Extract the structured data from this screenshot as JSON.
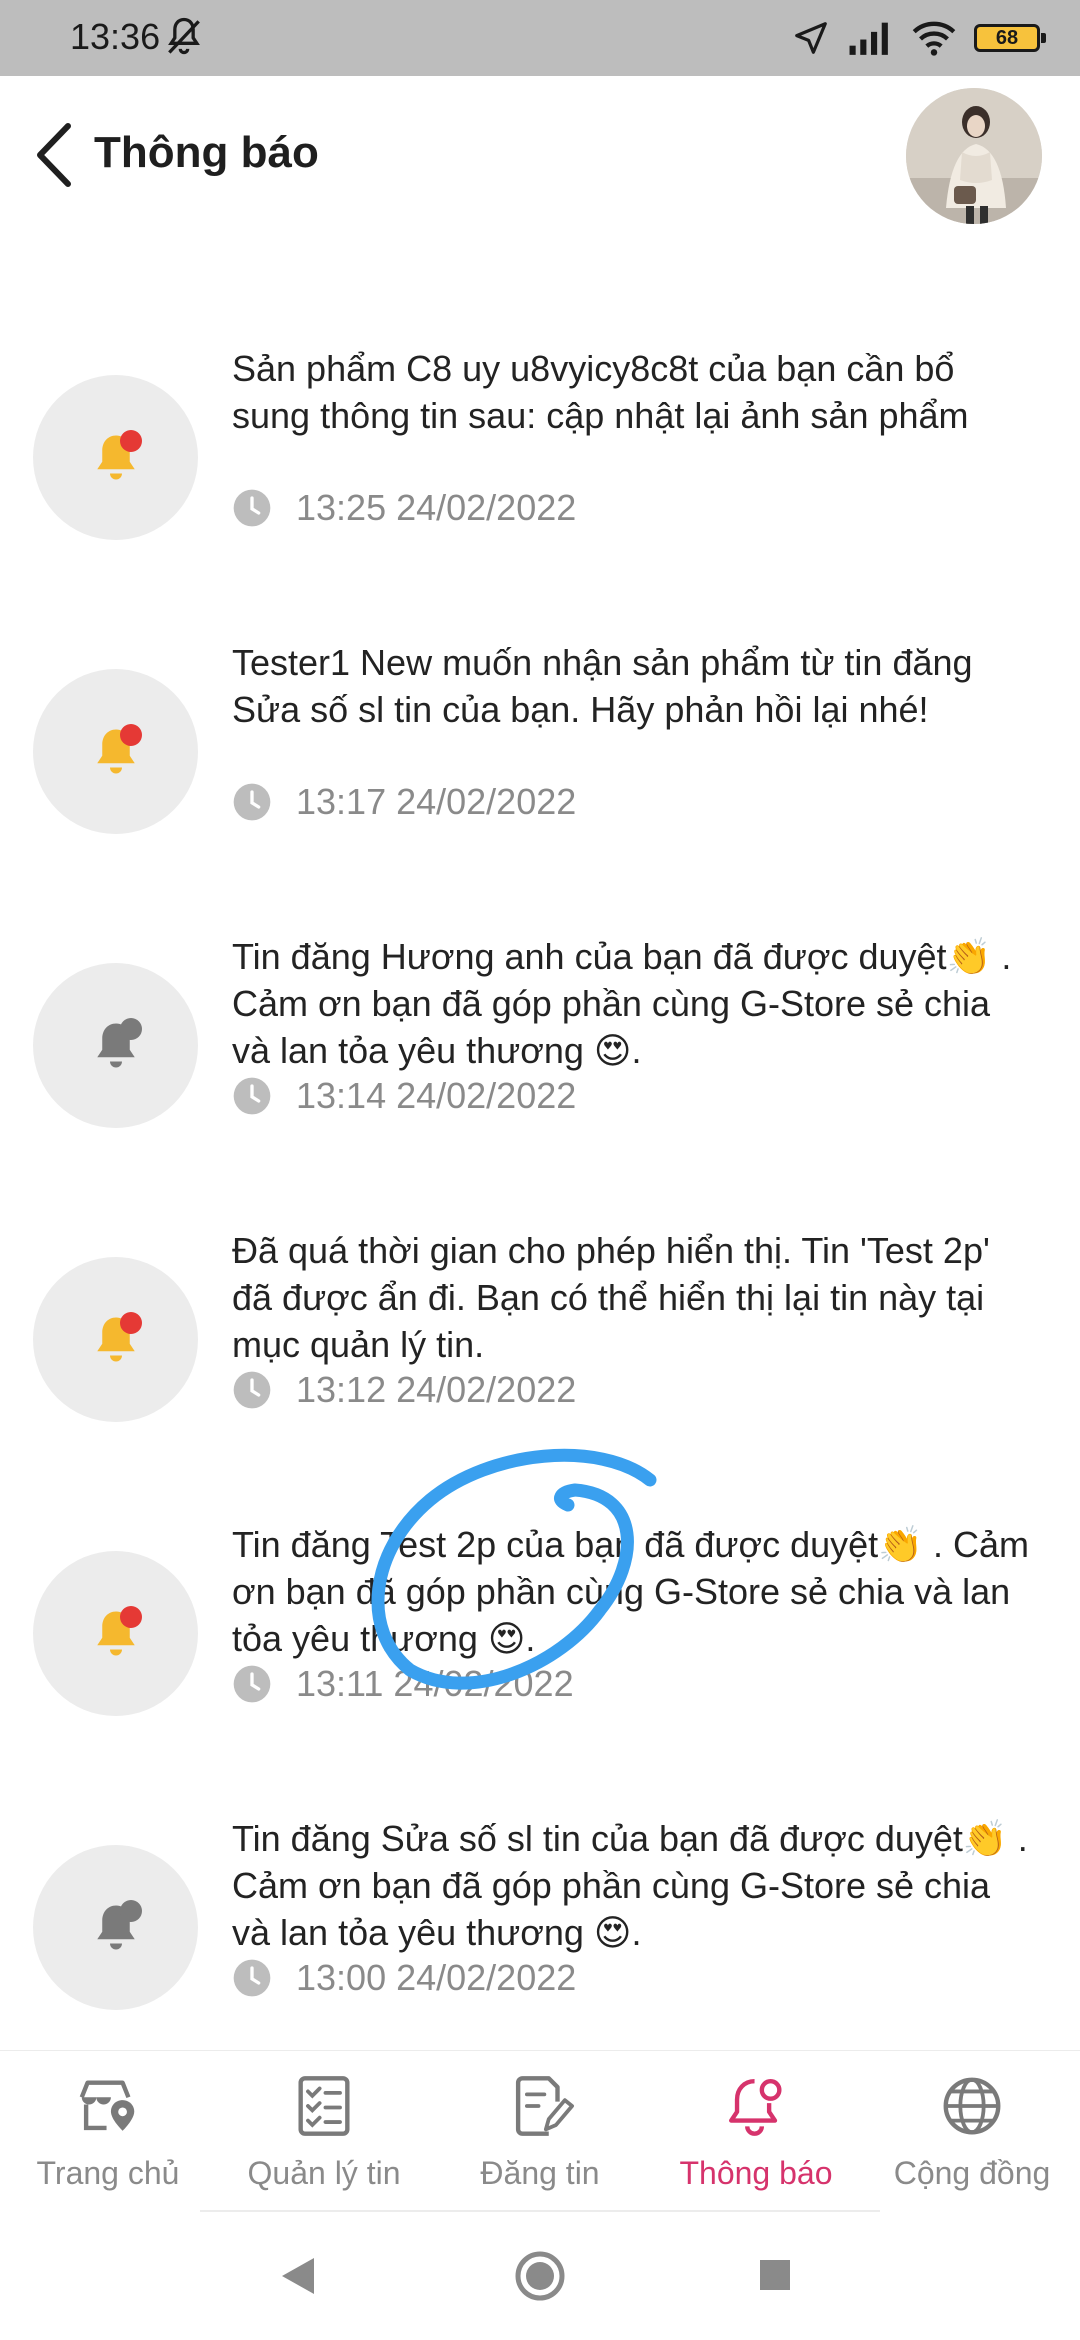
{
  "status_bar": {
    "time": "13:36",
    "battery": "68",
    "icons": [
      "bell-off-icon",
      "location-arrow-icon",
      "signal-icon",
      "wifi-icon",
      "battery-icon"
    ]
  },
  "header": {
    "title": "Thông báo",
    "back_icon": "chevron-left-icon"
  },
  "notifications": [
    {
      "text": "Sản phẩm C8 uy u8vyicy8c8t của bạn cần bổ sung thông tin sau: cập nhật lại ảnh sản phẩm",
      "time": "13:25 24/02/2022",
      "unread": true
    },
    {
      "text": "Tester1 New muốn nhận sản phẩm từ tin đăng Sửa số sl tin của bạn. Hãy phản hồi lại nhé!",
      "time": "13:17 24/02/2022",
      "unread": true
    },
    {
      "text": "Tin đăng Hương anh của bạn đã được duyệt👏 . Cảm ơn bạn đã góp phần cùng G-Store sẻ chia và lan tỏa yêu thương 😍.",
      "time": "13:14 24/02/2022",
      "unread": false
    },
    {
      "text": "Đã quá thời gian cho phép hiển thị. Tin 'Test 2p' đã được ẩn đi. Bạn có thể hiển thị lại tin này tại mục quản lý tin.",
      "time": "13:12 24/02/2022",
      "unread": true
    },
    {
      "text": "Tin đăng Test 2p của bạn đã được duyệt👏 . Cảm ơn bạn đã góp phần cùng G-Store sẻ chia và lan tỏa yêu thương 😍.",
      "time": "13:11 24/02/2022",
      "unread": true
    },
    {
      "text": "Tin đăng Sửa số sl tin của bạn đã được duyệt👏 . Cảm ơn bạn đã góp phần cùng G-Store sẻ chia và lan tỏa yêu thương 😍.",
      "time": "13:00 24/02/2022",
      "unread": false
    }
  ],
  "bottom_nav": {
    "items": [
      {
        "label": "Trang chủ",
        "icon": "store-location-icon"
      },
      {
        "label": "Quản lý tin",
        "icon": "checklist-icon"
      },
      {
        "label": "Đăng tin",
        "icon": "edit-document-icon"
      },
      {
        "label": "Thông báo",
        "icon": "bell-icon",
        "active": true
      },
      {
        "label": "Cộng đồng",
        "icon": "globe-icon"
      }
    ]
  },
  "colors": {
    "accent": "#d6336c",
    "unread_bell": "#f5b82e",
    "unread_dot": "#e53935",
    "read_bell": "#7a7a7a",
    "scribble": "#3aa0ef"
  }
}
